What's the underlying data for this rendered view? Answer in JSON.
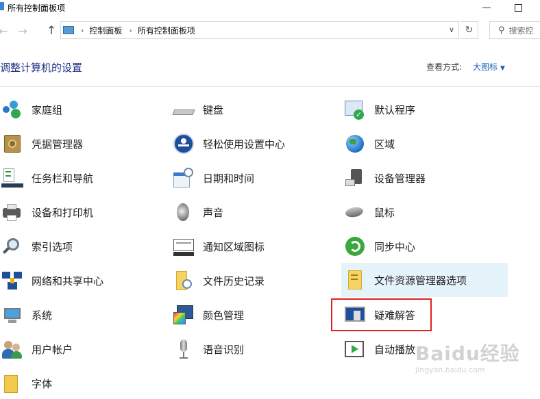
{
  "window": {
    "title": "所有控制面板项"
  },
  "address": {
    "crumbs": [
      "控制面板",
      "所有控制面板项"
    ],
    "search_placeholder": "搜索控"
  },
  "header": {
    "title": "调整计算机的设置",
    "view_label": "查看方式:",
    "view_value": "大图标"
  },
  "items": [
    {
      "label": "家庭组",
      "icon": "homegroup-icon"
    },
    {
      "label": "键盘",
      "icon": "keyboard-icon"
    },
    {
      "label": "默认程序",
      "icon": "default-programs-icon"
    },
    {
      "label": "凭据管理器",
      "icon": "credential-manager-icon"
    },
    {
      "label": "轻松使用设置中心",
      "icon": "ease-of-access-icon"
    },
    {
      "label": "区域",
      "icon": "region-globe-icon"
    },
    {
      "label": "任务栏和导航",
      "icon": "taskbar-icon"
    },
    {
      "label": "日期和时间",
      "icon": "date-time-icon"
    },
    {
      "label": "设备管理器",
      "icon": "device-manager-icon"
    },
    {
      "label": "设备和打印机",
      "icon": "printer-icon"
    },
    {
      "label": "声音",
      "icon": "speaker-icon"
    },
    {
      "label": "鼠标",
      "icon": "mouse-icon"
    },
    {
      "label": "索引选项",
      "icon": "indexing-icon"
    },
    {
      "label": "通知区域图标",
      "icon": "notification-icon"
    },
    {
      "label": "同步中心",
      "icon": "sync-center-icon"
    },
    {
      "label": "网络和共享中心",
      "icon": "network-icon"
    },
    {
      "label": "文件历史记录",
      "icon": "file-history-icon"
    },
    {
      "label": "文件资源管理器选项",
      "icon": "folder-options-icon"
    },
    {
      "label": "系统",
      "icon": "system-monitor-icon"
    },
    {
      "label": "颜色管理",
      "icon": "color-management-icon"
    },
    {
      "label": "疑难解答",
      "icon": "troubleshooting-icon"
    },
    {
      "label": "用户帐户",
      "icon": "user-accounts-icon"
    },
    {
      "label": "语音识别",
      "icon": "microphone-icon"
    },
    {
      "label": "自动播放",
      "icon": "autoplay-icon"
    },
    {
      "label": "字体",
      "icon": "fonts-icon"
    }
  ],
  "watermark": {
    "text": "Baidu经验",
    "sub": "jingyan.baidu.com"
  }
}
